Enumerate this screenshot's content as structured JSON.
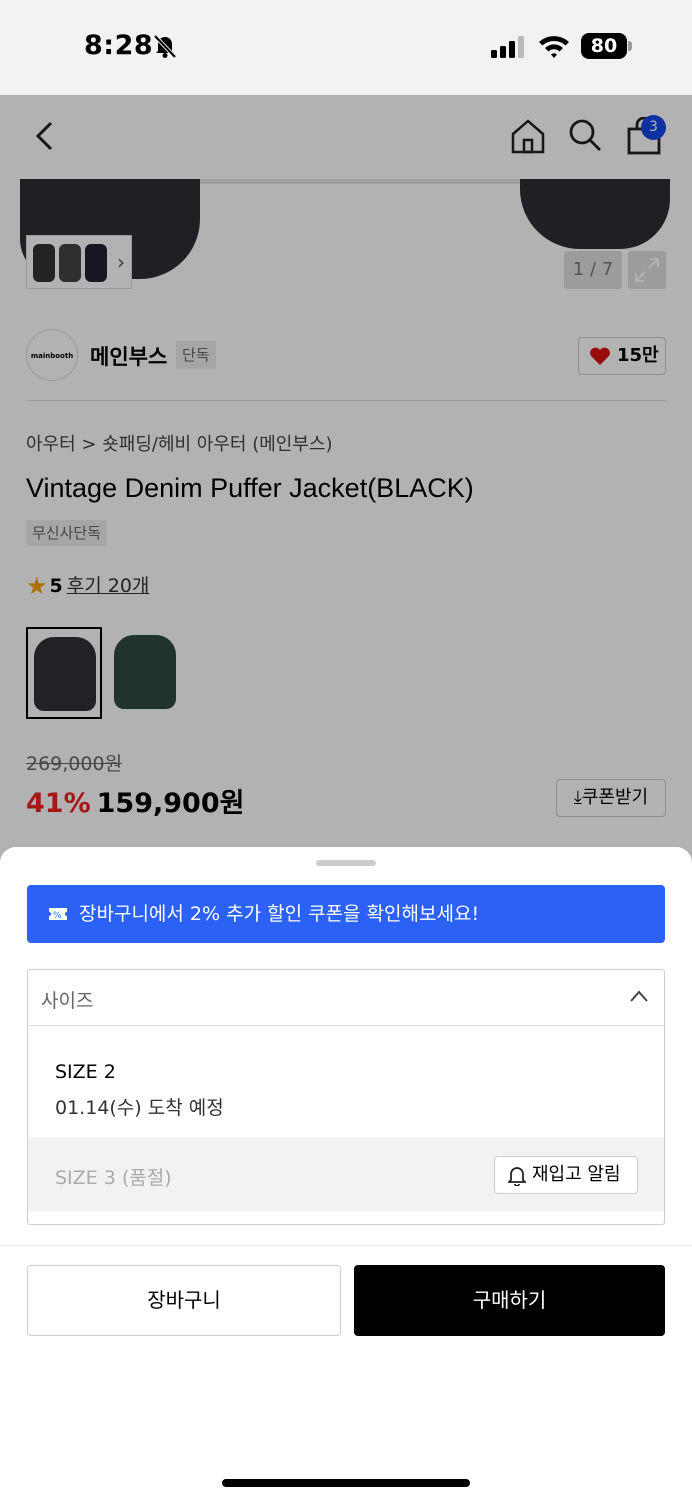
{
  "status_bar": {
    "time": "8:28",
    "battery": "80"
  },
  "nav": {
    "cart_count": "3"
  },
  "gallery": {
    "counter": "1 / 7"
  },
  "brand": {
    "logo_text": "mainbooth",
    "name": "메인부스",
    "badge": "단독",
    "likes": "15만"
  },
  "product": {
    "breadcrumb": "아우터 > 숏패딩/헤비 아우터 (메인부스)",
    "title": "Vintage Denim Puffer Jacket(BLACK)",
    "tag": "무신사단독",
    "rating": "5",
    "reviews": "후기 20개",
    "colors": [
      {
        "name": "black",
        "swatch": "#2e3236"
      },
      {
        "name": "green",
        "swatch": "#2f4a44"
      }
    ],
    "original_price": "269,000원",
    "discount": "41%",
    "price": "159,900원",
    "coupon_label": "쿠폰받기"
  },
  "sheet": {
    "promo": "장바구니에서 2% 추가 할인 쿠폰을 확인해보세요!",
    "size_placeholder": "사이즈",
    "options": [
      {
        "name": "SIZE 2",
        "eta": "01.14(수) 도착 예정"
      },
      {
        "name": "SIZE 3 (품절)",
        "action": "재입고 알림"
      }
    ],
    "cart_label": "장바구니",
    "buy_label": "구매하기"
  }
}
